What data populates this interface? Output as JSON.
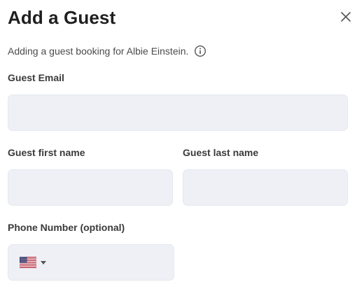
{
  "dialog": {
    "title": "Add a Guest",
    "subtitle": "Adding a guest booking for Albie Einstein."
  },
  "icons": {
    "close": "close-icon",
    "info": "info-circle-icon",
    "flag": "us-flag-icon",
    "caret": "caret-down-icon"
  },
  "form": {
    "email_label": "Guest Email",
    "email_value": "",
    "first_name_label": "Guest first name",
    "first_name_value": "",
    "last_name_label": "Guest last name",
    "last_name_value": "",
    "phone_label": "Phone Number (optional)",
    "phone_value": "",
    "phone_country": "US"
  },
  "colors": {
    "input_bg": "#eef0f6",
    "text": "#1f1f1f"
  }
}
